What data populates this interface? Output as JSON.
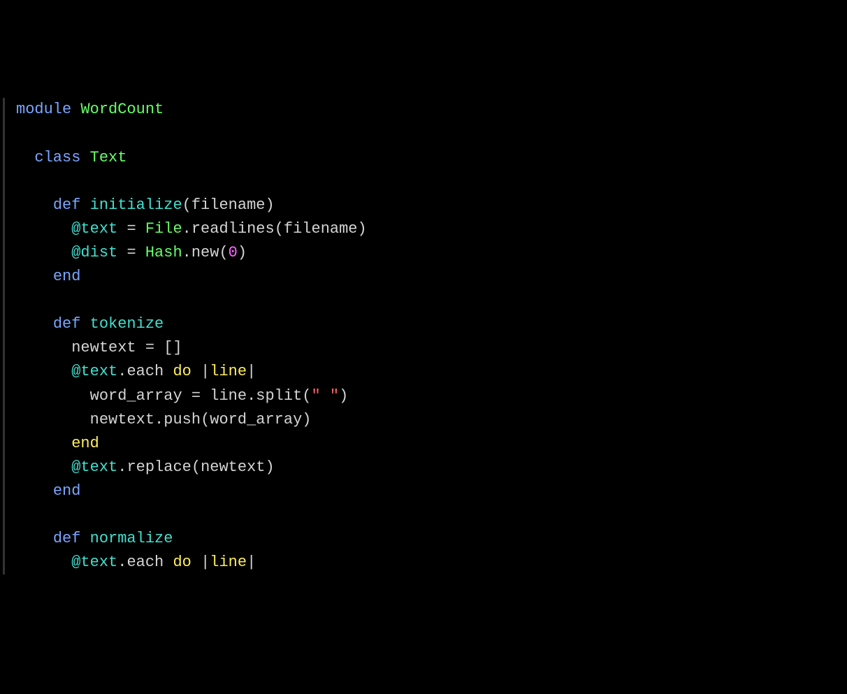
{
  "code": {
    "line1": {
      "module_kw": "module",
      "module_name": "WordCount"
    },
    "line3": {
      "class_kw": "class",
      "class_name": "Text"
    },
    "line5": {
      "def_kw": "def",
      "method_name": "initialize",
      "param": "filename"
    },
    "line6": {
      "ivar": "@text",
      "op": "=",
      "const": "File",
      "method": "readlines",
      "arg": "filename"
    },
    "line7": {
      "ivar": "@dist",
      "op": "=",
      "const": "Hash",
      "method": "new",
      "arg": "0"
    },
    "line8": {
      "end_kw": "end"
    },
    "line10": {
      "def_kw": "def",
      "method_name": "tokenize"
    },
    "line11": {
      "var": "newtext",
      "op": "=",
      "val": "[]"
    },
    "line12": {
      "ivar": "@text",
      "method": "each",
      "do_kw": "do",
      "pipe1": "|",
      "blockparam": "line",
      "pipe2": "|"
    },
    "line13": {
      "var": "word_array",
      "op": "=",
      "obj": "line",
      "method": "split",
      "arg": "\" \""
    },
    "line14": {
      "obj": "newtext",
      "method": "push",
      "arg": "word_array"
    },
    "line15": {
      "end_kw": "end"
    },
    "line16": {
      "ivar": "@text",
      "method": "replace",
      "arg": "newtext"
    },
    "line17": {
      "end_kw": "end"
    },
    "line19": {
      "def_kw": "def",
      "method_name": "normalize"
    },
    "line20": {
      "ivar": "@text",
      "method": "each",
      "do_kw": "do",
      "pipe1": "|",
      "blockparam": "line",
      "pipe2": "|"
    }
  }
}
